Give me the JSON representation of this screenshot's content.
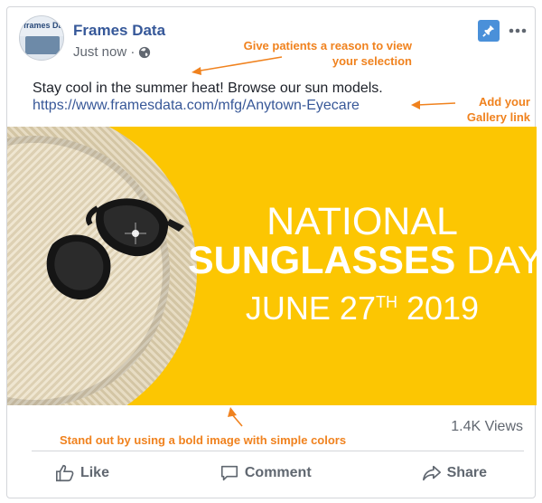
{
  "post": {
    "page_name": "Frames Data",
    "timestamp": "Just now ·",
    "avatar_text": "frames Data",
    "text": "Stay cool in the summer heat! Browse our sun models.",
    "link": "https://www.framesdata.com/mfg/Anytown-Eyecare"
  },
  "annotations": {
    "reason_line1": "Give patients a reason to view",
    "reason_line2": "your selection",
    "gallery_line1": "Add your",
    "gallery_line2": "Gallery link",
    "image_tip": "Stand out by using a bold image with simple colors"
  },
  "banner": {
    "line1": "NATIONAL",
    "line2_bold": "SUNGLASSES",
    "line2_rest": "DAY",
    "date_prefix": "JUNE 27",
    "date_sup": "TH",
    "date_suffix": "2019",
    "background_color": "#fcc602"
  },
  "stats": {
    "views": "1.4K Views"
  },
  "actions": {
    "like": "Like",
    "comment": "Comment",
    "share": "Share"
  },
  "icons": {
    "pin": "pin-icon",
    "more": "more-options-icon",
    "globe": "globe-icon",
    "like": "thumbs-up-icon",
    "comment": "comment-icon",
    "share": "share-icon"
  },
  "colors": {
    "link": "#385898",
    "page_name": "#365899",
    "annotation": "#f0821e",
    "pin_button": "#4a90d9"
  }
}
